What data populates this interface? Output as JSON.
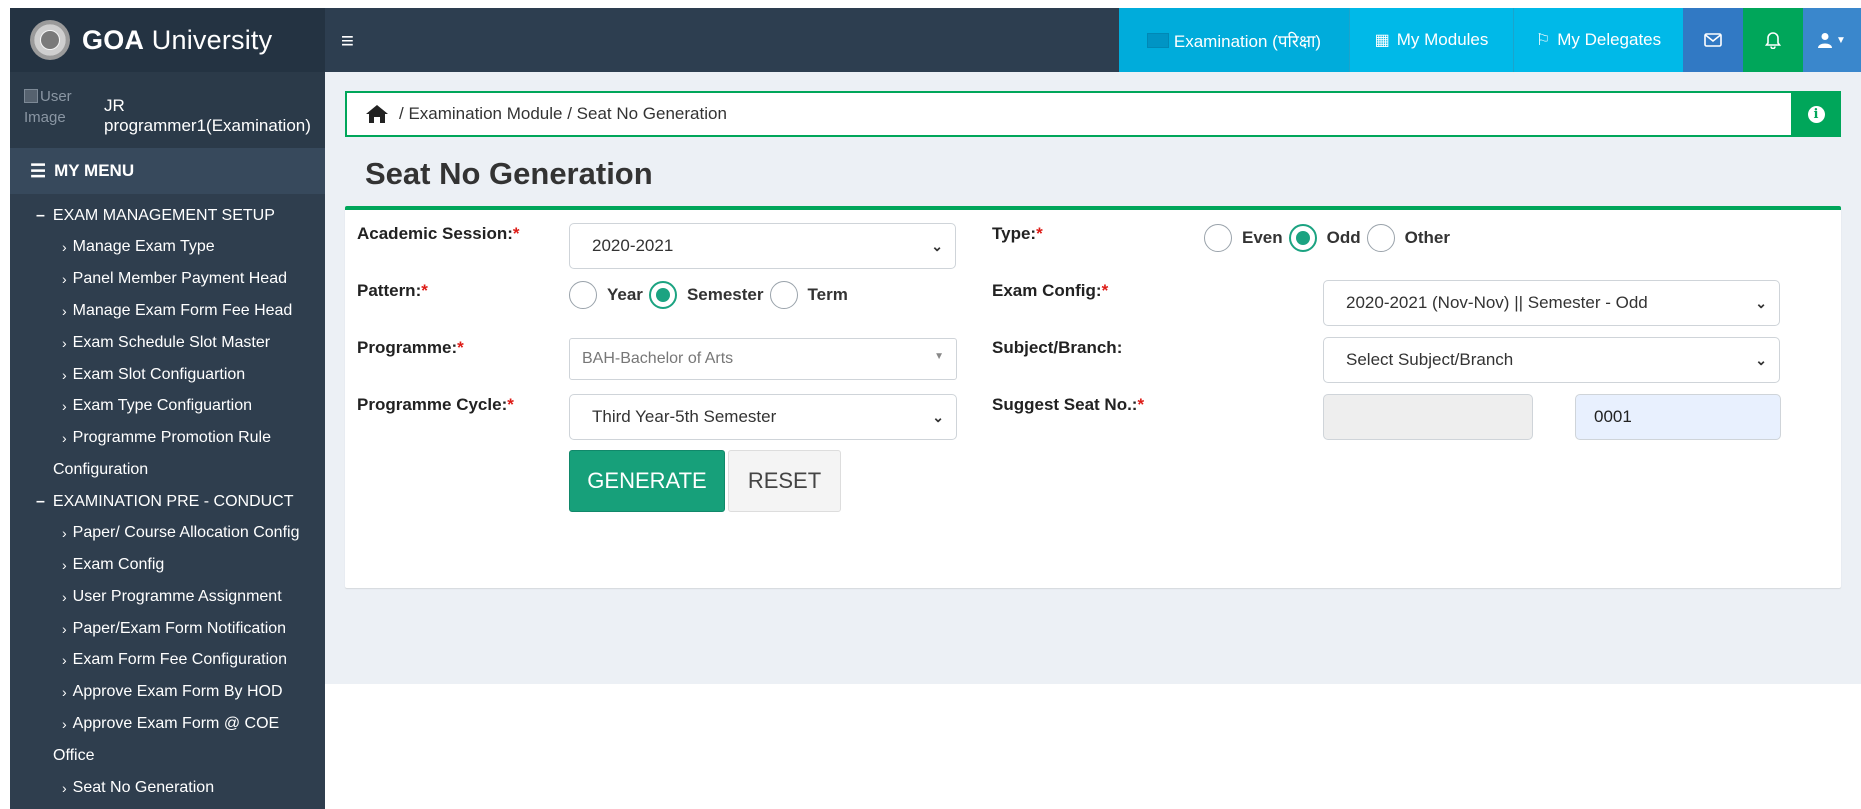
{
  "brand": {
    "bold": "GOA",
    "rest": " University"
  },
  "user": {
    "image_alt": "User Image",
    "name_line1": "JR",
    "name_line2": "programmer1(Examination)"
  },
  "menu": {
    "header": "MY MENU",
    "sections": [
      {
        "label": "EXAM MANAGEMENT SETUP"
      },
      {
        "label": "EXAMINATION PRE - CONDUCT"
      }
    ],
    "setup_items": [
      "Manage Exam Type",
      "Panel Member Payment Head",
      "Manage Exam Form Fee Head",
      "Exam Schedule Slot Master",
      "Exam Slot Configuartion",
      "Exam Type Configuartion",
      "Programme Promotion Rule"
    ],
    "setup_wrap": "Configuration",
    "preconduct_items": [
      "Paper/ Course Allocation Config",
      "Exam Config",
      "User Programme Assignment",
      "Paper/Exam Form Notification",
      "Exam Form Fee Configuration",
      "Approve Exam Form By HOD",
      "Approve Exam Form @ COE"
    ],
    "preconduct_wrap": "Office",
    "last_item": "Seat No Generation"
  },
  "topbar": {
    "toggle": "≡",
    "examination": "Examination (परिक्षा)",
    "modules": "My Modules",
    "delegates": "My Delegates",
    "mail_icon": "envelope-icon",
    "bell_icon": "bell-icon",
    "user_icon": "user-icon"
  },
  "breadcrumb": {
    "path": "/ Examination Module / Seat No Generation"
  },
  "page": {
    "title": "Seat No Generation"
  },
  "form": {
    "academic_session": {
      "label": "Academic Session:",
      "value": "2020-2021"
    },
    "type": {
      "label": "Type:",
      "options": [
        "Even",
        "Odd",
        "Other"
      ],
      "selected": "Odd"
    },
    "pattern": {
      "label": "Pattern:",
      "options": [
        "Year",
        "Semester",
        "Term"
      ],
      "selected": "Semester"
    },
    "exam_config": {
      "label": "Exam Config:",
      "value": "2020-2021 (Nov-Nov) || Semester - Odd"
    },
    "programme": {
      "label": "Programme:",
      "value": "BAH-Bachelor of Arts"
    },
    "subject_branch": {
      "label": "Subject/Branch:",
      "value": "Select Subject/Branch"
    },
    "programme_cycle": {
      "label": "Programme Cycle:",
      "value": "Third Year-5th Semester"
    },
    "suggest_seat": {
      "label": "Suggest Seat No.:",
      "prefix": "",
      "number": "0001"
    },
    "generate": "GENERATE",
    "reset": "RESET"
  },
  "colors": {
    "accent": "#00a65a",
    "primary_button": "#17a07a",
    "sidebar": "#2f3e4e",
    "topbar": "#2d3e50",
    "required": "#dd1b16"
  }
}
